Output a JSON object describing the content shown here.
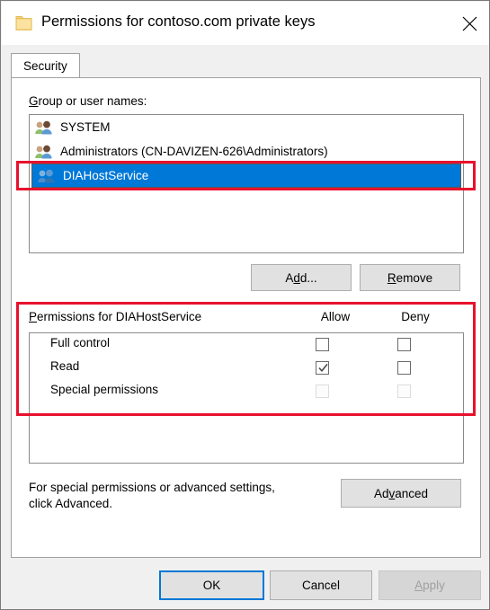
{
  "window": {
    "title": "Permissions for contoso.com private keys",
    "icon": "folder-icon",
    "close_label": "Close"
  },
  "tabs": [
    {
      "label": "Security",
      "active": true
    }
  ],
  "groups_section": {
    "label": "Group or user names:",
    "accesskey": "G",
    "items": [
      {
        "name": "SYSTEM",
        "selected": false,
        "icon": "users-group-icon"
      },
      {
        "name": "Administrators (CN-DAVIZEN-626\\Administrators)",
        "selected": false,
        "icon": "users-group-icon"
      },
      {
        "name": "DIAHostService",
        "selected": true,
        "icon": "users-group-icon"
      }
    ],
    "add_label": "Add...",
    "add_accesskey": "d",
    "remove_label": "Remove",
    "remove_accesskey": "R"
  },
  "permissions_section": {
    "title_prefix": "Permissions for ",
    "title_subject": "DIAHostService",
    "accesskey": "P",
    "allow_header": "Allow",
    "deny_header": "Deny",
    "rows": [
      {
        "name": "Full control",
        "allow": false,
        "deny": false,
        "enabled": true
      },
      {
        "name": "Read",
        "allow": true,
        "deny": false,
        "enabled": true
      },
      {
        "name": "Special permissions",
        "allow": false,
        "deny": false,
        "enabled": false
      }
    ]
  },
  "hint": {
    "line1": "For special permissions or advanced settings,",
    "line2": "click Advanced.",
    "advanced_label": "Advanced",
    "advanced_accesskey": "v"
  },
  "footer": {
    "ok_label": "OK",
    "cancel_label": "Cancel",
    "apply_label": "Apply",
    "apply_accesskey": "A",
    "apply_disabled": true
  },
  "colors": {
    "selection_blue": "#0078d7",
    "annotation_red": "#e8112d",
    "dialog_background": "#f0f0f0",
    "panel_white": "#ffffff",
    "button_face": "#e1e1e1"
  }
}
